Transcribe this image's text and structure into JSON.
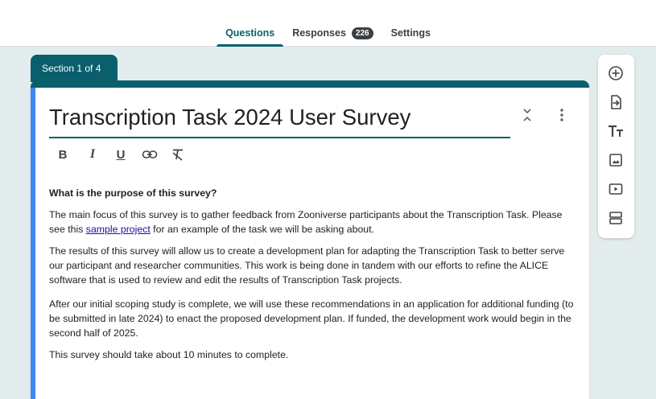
{
  "tabs": [
    {
      "label": "Questions",
      "active": true
    },
    {
      "label": "Responses",
      "badge": "226"
    },
    {
      "label": "Settings"
    }
  ],
  "section": {
    "label": "Section 1 of 4"
  },
  "form": {
    "title": "Transcription Task 2024 User Survey",
    "format_tools": {
      "bold": "B",
      "italic": "I",
      "underline": "U"
    },
    "description": {
      "heading": "What is the purpose of this survey?",
      "p1_before": "The main focus of this survey is to gather feedback from Zooniverse participants about the Transcription Task. Please see this ",
      "p1_link": "sample project",
      "p1_after": " for an example of the task we will be asking about.",
      "p2": "The results of this survey will allow us to create a development plan for adapting the Transcription Task to better serve our participant and researcher communities. This work is being done in tandem with our efforts to refine the ALICE software that is used to review and edit the results of Transcription Task projects.",
      "p3": "After our initial scoping study is complete, we will use these recommendations in an application for additional funding (to be submitted in late 2024) to enact the proposed development plan. If funded, the development work would begin in the second half of 2025.",
      "p4": "This survey should take about 10 minutes to complete."
    }
  },
  "side_toolbar": {
    "tools": [
      "add-question-icon",
      "import-questions-icon",
      "add-title-icon",
      "add-image-icon",
      "add-video-icon",
      "add-section-icon"
    ]
  },
  "colors": {
    "accent": "#0a5f6c",
    "focus": "#4285f4",
    "background": "#e3eced"
  }
}
